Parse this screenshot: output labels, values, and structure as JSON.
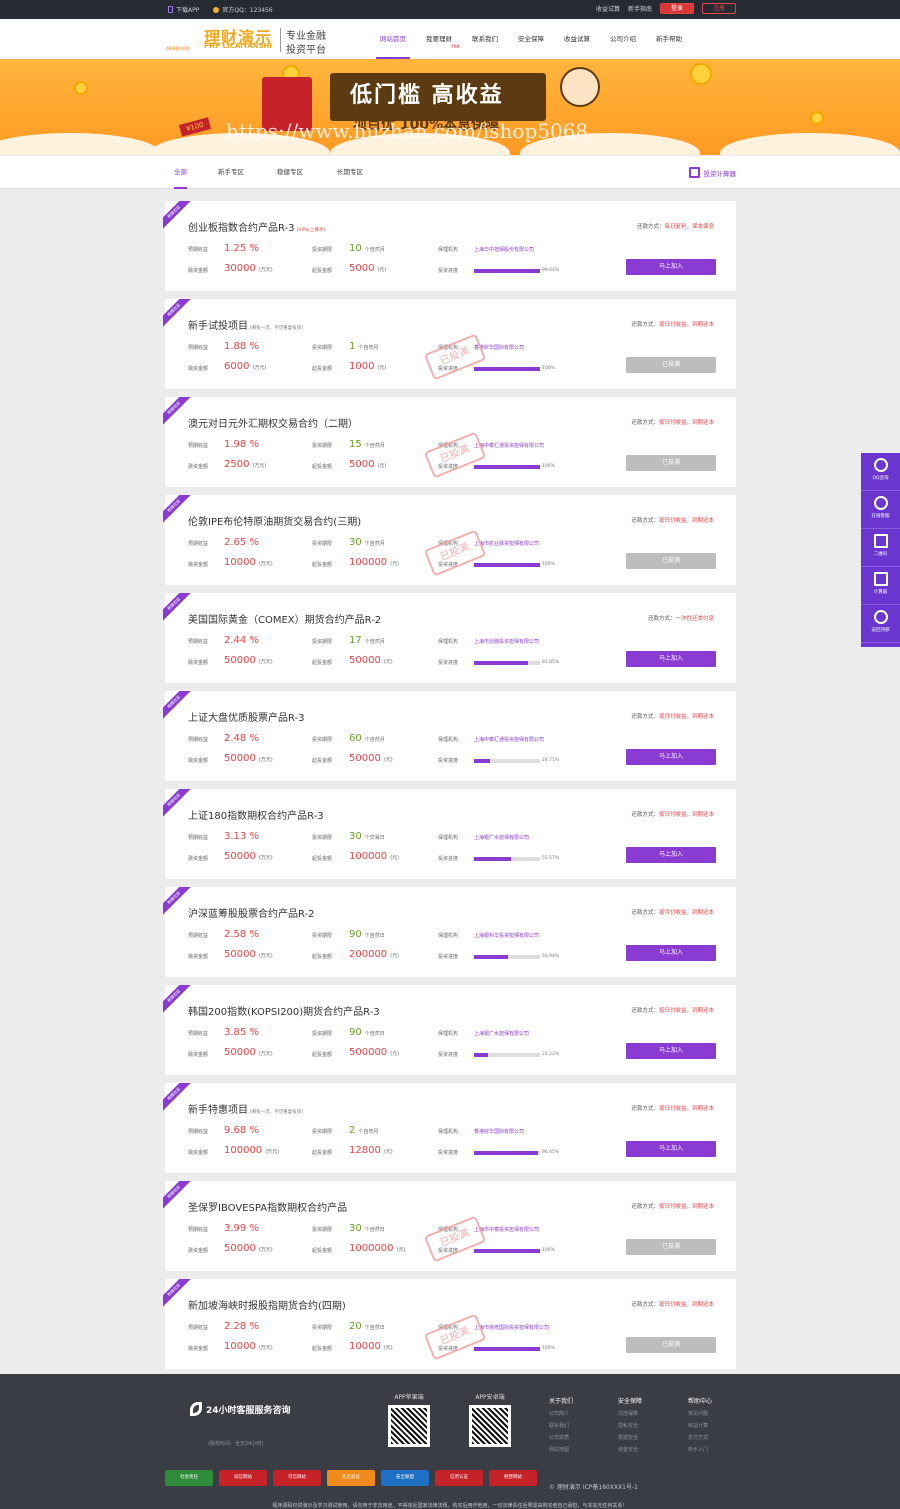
{
  "topbar": {
    "download_app": "下载APP",
    "qq": "官方QQ：123456",
    "profit_calc": "收益试算",
    "guide": "新手指南",
    "login": "登录",
    "register": "注册"
  },
  "logo": {
    "brand": "理财演示",
    "brand_en": "PHP LICAIYANSHI",
    "brand_small": "ABP理财系统",
    "slogan1": "专业金融",
    "slogan2": "投资平台"
  },
  "nav": [
    {
      "label": "网站首页",
      "active": true,
      "hot": ""
    },
    {
      "label": "我要理财",
      "active": false,
      "hot": "Hot"
    },
    {
      "label": "联系我们",
      "active": false,
      "hot": ""
    },
    {
      "label": "安全保障",
      "active": false,
      "hot": ""
    },
    {
      "label": "收益试算",
      "active": false,
      "hot": ""
    },
    {
      "label": "公司介绍",
      "active": false,
      "hot": ""
    },
    {
      "label": "新手帮助",
      "active": false,
      "hot": ""
    }
  ],
  "banner": {
    "headline": "低门槛  高收益",
    "sub": "项目优 100%本息保障",
    "watermark": "https://www.huzhan.com/ishop5068",
    "coupon": "¥100"
  },
  "filter_tabs": [
    "全部",
    "新手专区",
    "稳健专区",
    "长期专区"
  ],
  "calculator_label": "投资计算器",
  "labels": {
    "rate": "预期收益",
    "amount": "融资金额",
    "term": "投资期限",
    "min": "起投金额",
    "guarantor": "保理机构",
    "progress": "投资进度",
    "repay": "还款方式：",
    "unit_wan": "(万元)",
    "unit_yuan": "(元)"
  },
  "ribbon": "稳健收益",
  "products": [
    {
      "title": "创业板指数合约产品R-3",
      "tag": "(VIP以上尊享)",
      "tag_red": true,
      "repay": "每日复利，保本保息",
      "rate": "1.25 %",
      "amount": "30000",
      "term": "10",
      "term_unit": "个自然月",
      "min": "5000",
      "guarantor": "上海华中担保股份有限公司",
      "progress": 0.9964,
      "progress_text": "99.64%",
      "status": "马上加入",
      "open": true
    },
    {
      "title": "新手试投项目",
      "tag": "(限投一次，不可重复投资)",
      "tag_red": false,
      "repay": "按日付收益，到期还本",
      "rate": "1.88 %",
      "amount": "6000",
      "term": "1",
      "term_unit": "个自然月",
      "min": "1000",
      "guarantor": "香港财华国际有限公司",
      "progress": 1.0,
      "progress_text": "100%",
      "status": "已投满",
      "open": false
    },
    {
      "title": "澳元对日元外汇期权交易合约（二期）",
      "tag": "",
      "tag_red": false,
      "repay": "按日付收益，到期还本",
      "rate": "1.98 %",
      "amount": "2500",
      "term": "15",
      "term_unit": "个自然月",
      "min": "5000",
      "guarantor": "上海中泰汇通投资担保有限公司",
      "progress": 1.0,
      "progress_text": "100%",
      "status": "已投满",
      "open": false
    },
    {
      "title": "伦敦IPE布伦特原油期货交易合约(三期)",
      "tag": "",
      "tag_red": false,
      "repay": "按日付收益，到期还本",
      "rate": "2.65 %",
      "amount": "10000",
      "term": "30",
      "term_unit": "个自然月",
      "min": "100000",
      "guarantor": "上海市农业融资担保有限公司",
      "progress": 1.0,
      "progress_text": "100%",
      "status": "已投满",
      "open": false
    },
    {
      "title": "美国国际黄金（COMEX）期货合约产品R-2",
      "tag": "",
      "tag_red": false,
      "repay": "一次性还本付息",
      "rate": "2.44 %",
      "amount": "50000",
      "term": "17",
      "term_unit": "个自然月",
      "min": "50000",
      "guarantor": "上海市创融投资担保有限公司",
      "progress": 0.8185,
      "progress_text": "81.85%",
      "status": "马上加入",
      "open": true
    },
    {
      "title": "上证大盘优质股票产品R-3",
      "tag": "",
      "tag_red": false,
      "repay": "按月付收益，到期还本",
      "rate": "2.48 %",
      "amount": "50000",
      "term": "60",
      "term_unit": "个自然月",
      "min": "50000",
      "guarantor": "上海中泰汇通投资担保有限公司",
      "progress": 0.2471,
      "progress_text": "24.71%",
      "status": "马上加入",
      "open": true
    },
    {
      "title": "上证180指数期权合约产品R-3",
      "tag": "",
      "tag_red": false,
      "repay": "按日付收益，到期还本",
      "rate": "3.13 %",
      "amount": "50000",
      "term": "30",
      "term_unit": "个交易日",
      "min": "100000",
      "guarantor": "上海银广水担保有限公司",
      "progress": 0.5557,
      "progress_text": "55.57%",
      "status": "马上加入",
      "open": true
    },
    {
      "title": "沪深蓝筹股股票合约产品R-2",
      "tag": "",
      "tag_red": false,
      "repay": "按月付收益，到期还本",
      "rate": "2.58 %",
      "amount": "50000",
      "term": "90",
      "term_unit": "个自然日",
      "min": "200000",
      "guarantor": "上海银科华投资担保有限公司",
      "progress": 0.5094,
      "progress_text": "50.94%",
      "status": "马上加入",
      "open": true
    },
    {
      "title": "韩国200指数(KOPSI200)期货合约产品R-3",
      "tag": "",
      "tag_red": false,
      "repay": "按日付收益，到期还本",
      "rate": "3.85 %",
      "amount": "50000",
      "term": "90",
      "term_unit": "个自然日",
      "min": "500000",
      "guarantor": "上海银广水担保有限公司",
      "progress": 0.2122,
      "progress_text": "21.22%",
      "status": "马上加入",
      "open": true
    },
    {
      "title": "新手特惠项目",
      "tag": "(限投一次，不可重复投资)",
      "tag_red": false,
      "repay": "按日付收益，到期还本",
      "rate": "9.68 %",
      "amount": "100000",
      "term": "2",
      "term_unit": "个自然月",
      "min": "12800",
      "guarantor": "香港财华国际有限公司",
      "progress": 0.9645,
      "progress_text": "96.45%",
      "status": "马上加入",
      "open": true
    },
    {
      "title": "圣保罗IBOVESPA指数期权合约产品",
      "tag": "",
      "tag_red": false,
      "repay": "按日付收益，到期还本",
      "rate": "3.99 %",
      "amount": "50000",
      "term": "30",
      "term_unit": "个自然日",
      "min": "1000000",
      "guarantor": "上海市中泰投资担保有限公司",
      "progress": 1.0,
      "progress_text": "100%",
      "status": "已投满",
      "open": false
    },
    {
      "title": "新加坡海峡时报股指期货合约(四期)",
      "tag": "",
      "tag_red": false,
      "repay": "按日付收益，到期还本",
      "rate": "2.28 %",
      "amount": "10000",
      "term": "20",
      "term_unit": "个自然日",
      "min": "10000",
      "guarantor": "上海市房修国际投资担保有限公司",
      "progress": 1.0,
      "progress_text": "100%",
      "status": "已投满",
      "open": false
    }
  ],
  "stamp_text": "已投满",
  "side": [
    {
      "label": "QQ咨询",
      "icon": "qq-icon"
    },
    {
      "label": "在线客服",
      "icon": "headset-icon"
    },
    {
      "label": "二维码",
      "icon": "qr-icon"
    },
    {
      "label": "计算器",
      "icon": "calculator-icon"
    },
    {
      "label": "返回顶部",
      "icon": "rocket-icon"
    }
  ],
  "footer": {
    "hotline": "24小时客服服务咨询",
    "hours": "(服务时间：全天24小时)",
    "app_ios": "APP苹果端",
    "app_android": "APP安卓端",
    "cols": [
      {
        "title": "关于我们",
        "items": [
          "公司简介",
          "联系我们",
          "公司资质",
          "网站地图"
        ]
      },
      {
        "title": "安全保障",
        "items": [
          "风控保障",
          "隐私安全",
          "数据安全",
          "资金安全"
        ]
      },
      {
        "title": "帮助中心",
        "items": [
          "常见问题",
          "收益计算",
          "支付方式",
          "新手入门"
        ]
      }
    ],
    "badges": [
      "社会责任",
      "诚信网站",
      "可信网站",
      "实名验证",
      "安全联盟",
      "信用认证",
      "经营网站"
    ],
    "copyright": "© 理财演示 ICP备160XXX1号-1",
    "notice": "程序源码仅供演示及学习测试使用，请勿用于非法用途，不得违反国家法律法规，购买后用作他用，一切法律责任后果需由购买者自己承担，与本站无任何关系！"
  },
  "colors": {
    "accent": "#8a3bd1",
    "rate_red": "#e24747",
    "term_green": "#6a9e21",
    "banner_orange": "#ff9a23"
  }
}
